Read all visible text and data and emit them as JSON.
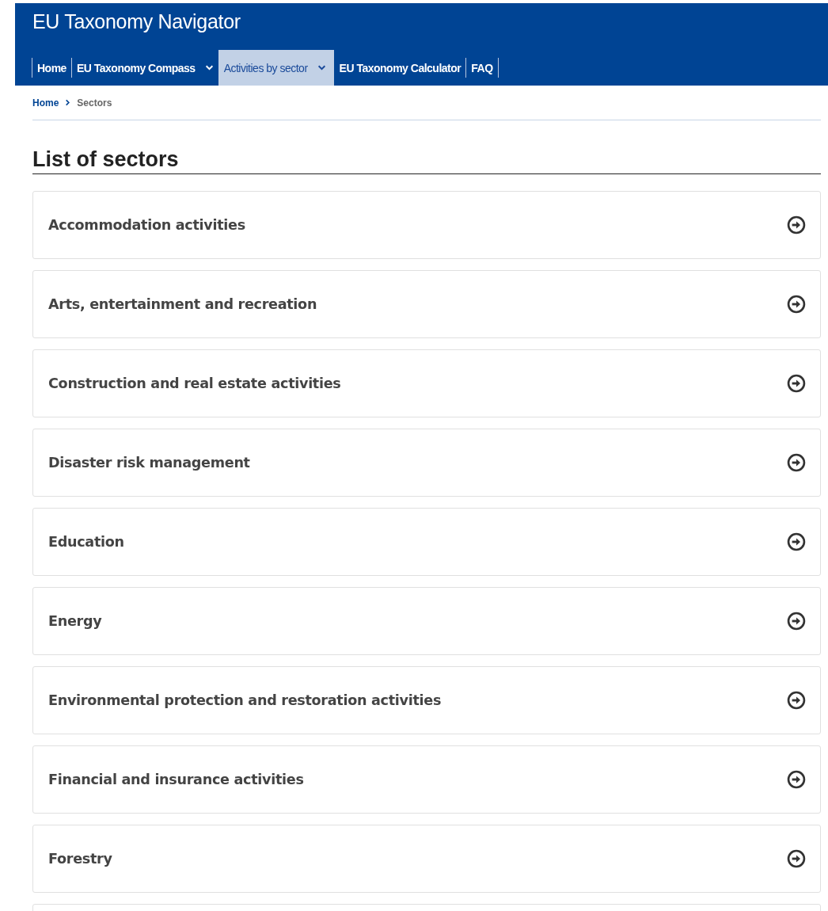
{
  "header": {
    "title": "EU Taxonomy Navigator"
  },
  "nav": [
    {
      "label": "Home",
      "dropdown": false,
      "selected": false
    },
    {
      "label": "EU Taxonomy Compass",
      "dropdown": true,
      "selected": false
    },
    {
      "label": "Activities by sector",
      "dropdown": true,
      "selected": true
    },
    {
      "label": "EU Taxonomy Calculator",
      "dropdown": false,
      "selected": false
    },
    {
      "label": "FAQ",
      "dropdown": false,
      "selected": false
    }
  ],
  "breadcrumb": [
    {
      "label": "Home",
      "kind": "link"
    },
    {
      "label": "Sectors",
      "kind": "current"
    }
  ],
  "heading": "List of sectors",
  "sectors": [
    "Accommodation activities",
    "Arts, entertainment and recreation",
    "Construction and real estate activities",
    "Disaster risk management",
    "Education",
    "Energy",
    "Environmental protection and restoration activities",
    "Financial and insurance activities",
    "Forestry"
  ]
}
